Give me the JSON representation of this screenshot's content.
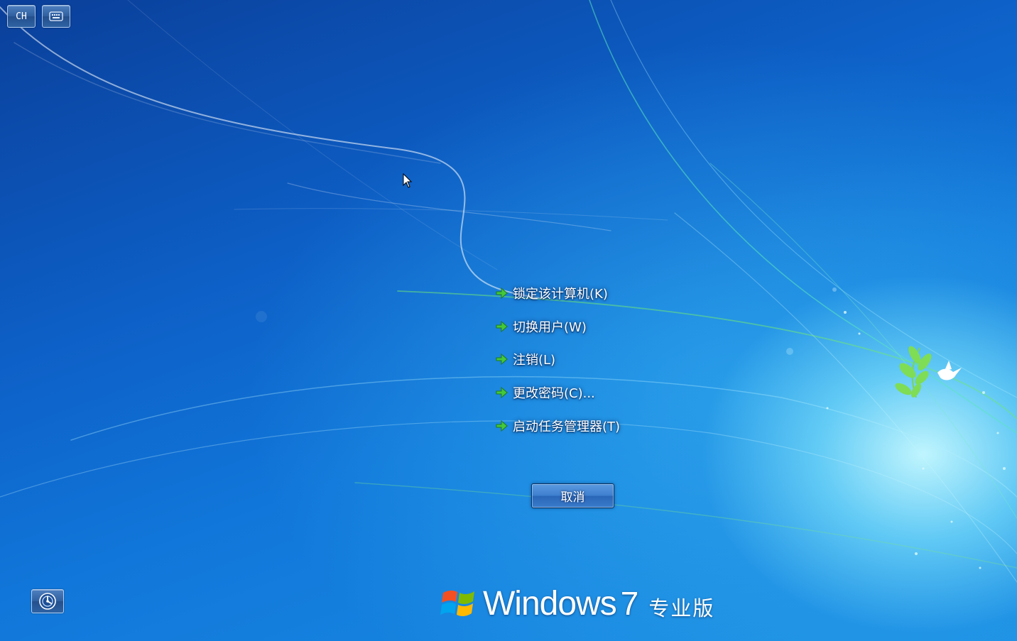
{
  "top_toolbar": {
    "language_label": "CH",
    "keyboard_icon": "keyboard-icon"
  },
  "menu": {
    "items": [
      {
        "label": "锁定该计算机(K)",
        "icon": "green-arrow-icon"
      },
      {
        "label": "切换用户(W)",
        "icon": "green-arrow-icon"
      },
      {
        "label": "注销(L)",
        "icon": "green-arrow-icon"
      },
      {
        "label": "更改密码(C)...",
        "icon": "green-arrow-icon"
      },
      {
        "label": "启动任务管理器(T)",
        "icon": "green-arrow-icon"
      }
    ]
  },
  "cancel_label": "取消",
  "ease_of_access_icon": "ease-of-access-icon",
  "branding": {
    "name": "Windows",
    "version": "7",
    "edition": "专业版"
  },
  "colors": {
    "background_dark": "#0a3f9a",
    "background_light": "#1b8fe4",
    "glow": "#c8faff",
    "arrow_green": "#3fc23a",
    "button_blue": "#3f7fcf"
  }
}
